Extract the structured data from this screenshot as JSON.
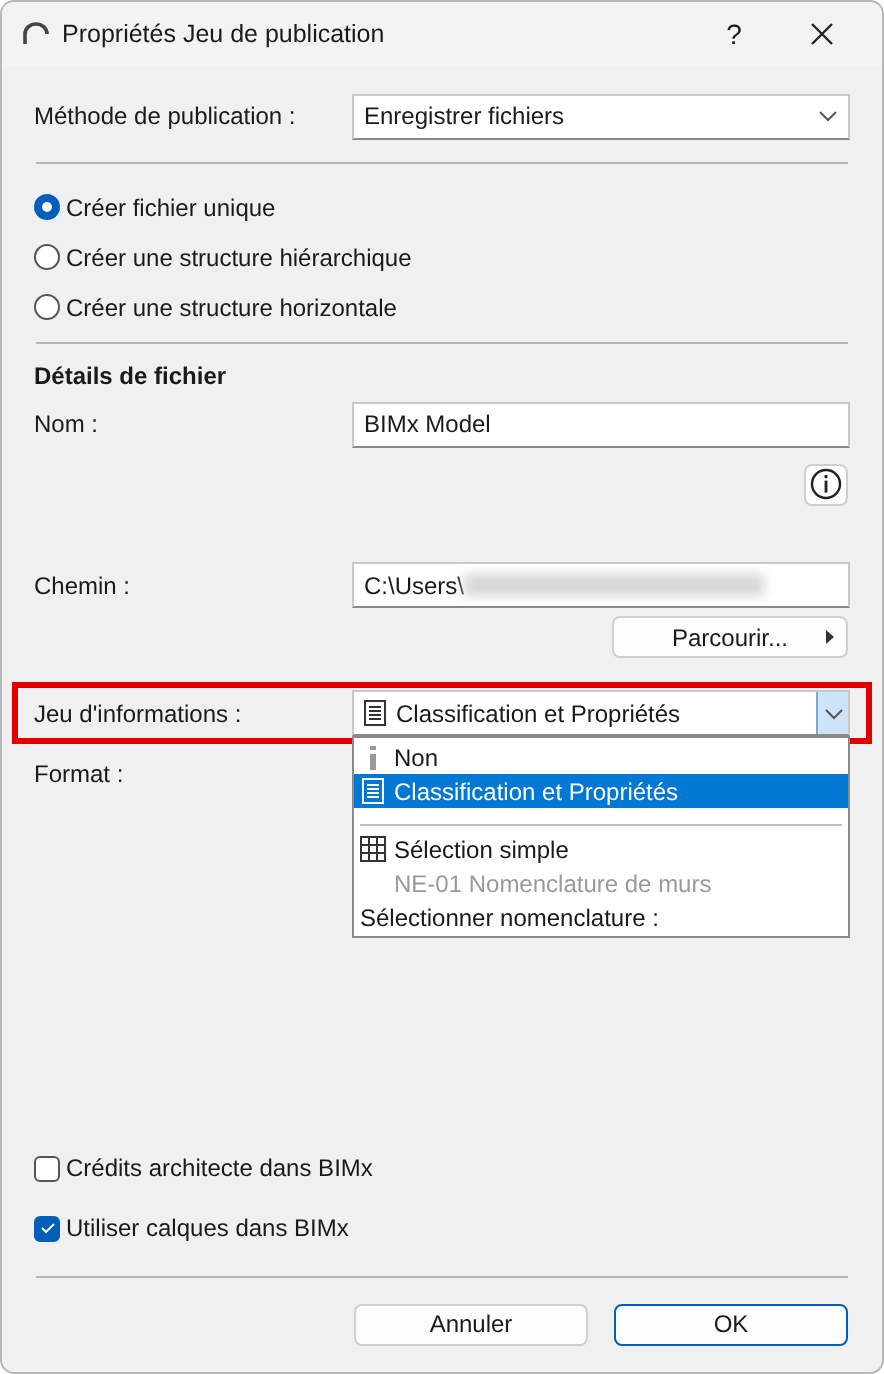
{
  "window": {
    "title": "Propriétés Jeu de publication",
    "help": "?"
  },
  "publish_method": {
    "label": "Méthode de publication :",
    "value": "Enregistrer fichiers"
  },
  "structure_options": [
    {
      "label": "Créer fichier unique",
      "selected": true
    },
    {
      "label": "Créer une structure hiérarchique",
      "selected": false
    },
    {
      "label": "Créer une structure horizontale",
      "selected": false
    }
  ],
  "file_details": {
    "heading": "Détails de fichier",
    "name": {
      "label": "Nom :",
      "value": "BIMx Model"
    },
    "path": {
      "label": "Chemin :",
      "value": "C:\\Users\\"
    },
    "browse_button": "Parcourir..."
  },
  "info_set": {
    "label": "Jeu d'informations :",
    "value": "Classification et Propriétés",
    "highlighted": true,
    "expanded": true,
    "options": [
      {
        "kind": "option",
        "label": "Non",
        "selected": false,
        "disabled": false
      },
      {
        "kind": "option",
        "label": "Classification et Propriétés",
        "selected": true,
        "disabled": false
      },
      {
        "kind": "blank"
      },
      {
        "kind": "separator"
      },
      {
        "kind": "option",
        "label": "Sélection simple",
        "selected": false,
        "disabled": false
      },
      {
        "kind": "option",
        "label": "NE-01 Nomenclature de murs",
        "selected": false,
        "disabled": true
      },
      {
        "kind": "heading",
        "label": "Sélectionner nomenclature :"
      }
    ]
  },
  "format": {
    "label": "Format :"
  },
  "checkboxes": [
    {
      "label": "Crédits architecte dans BIMx",
      "checked": false
    },
    {
      "label": "Utiliser calques dans BIMx",
      "checked": true
    }
  ],
  "buttons": [
    {
      "label": "Annuler",
      "default": false
    },
    {
      "label": "OK",
      "default": true
    }
  ]
}
